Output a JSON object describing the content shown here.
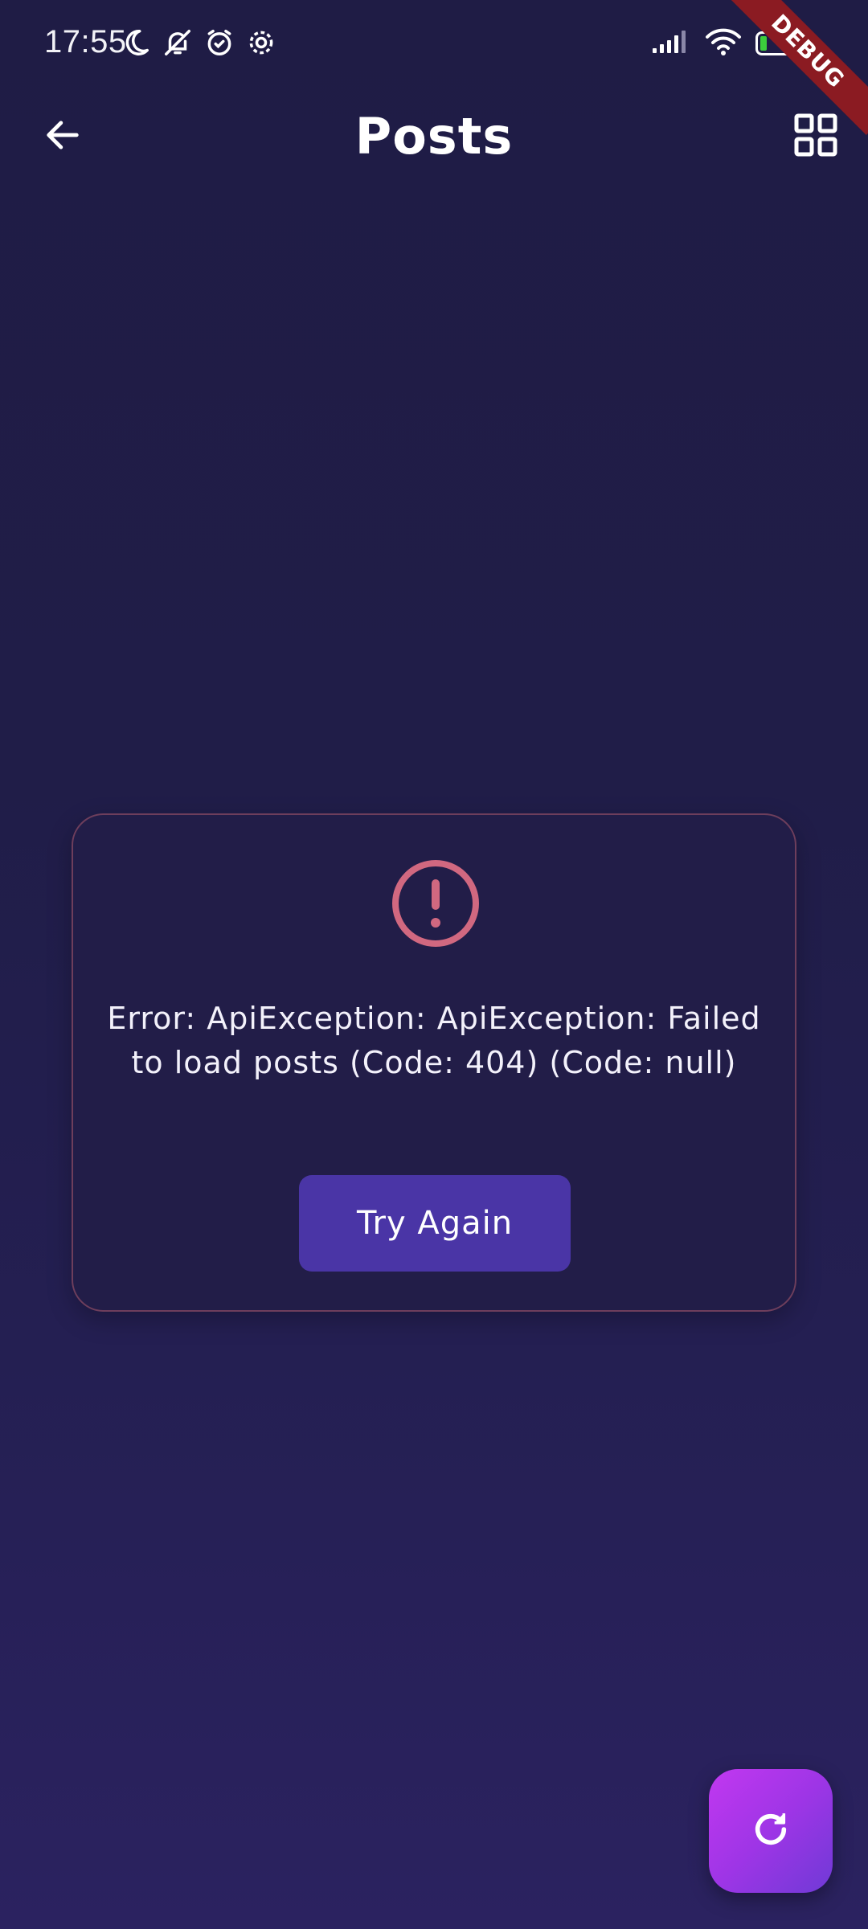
{
  "status_bar": {
    "time": "17:55",
    "battery_level": "19",
    "icons": [
      "moon-icon",
      "bell-off-icon",
      "alarm-icon",
      "settings-gear-icon",
      "signal-icon",
      "wifi-icon",
      "battery-icon"
    ]
  },
  "debug_banner": {
    "label": "DEBUG",
    "color": "#8b1b22"
  },
  "app_bar": {
    "title": "Posts",
    "back_icon": "arrow-left-icon",
    "view_toggle_icon": "grid-view-icon"
  },
  "error_card": {
    "icon": "alert-circle-icon",
    "message": "Error: ApiException: ApiException: Failed to load posts (Code: 404) (Code: null)",
    "retry_label": "Try Again",
    "accent_color": "#d16880",
    "button_color": "#4a35a6"
  },
  "fab": {
    "icon": "refresh-icon",
    "color": "#b037ec"
  },
  "theme": {
    "background": "#1f1c45"
  }
}
